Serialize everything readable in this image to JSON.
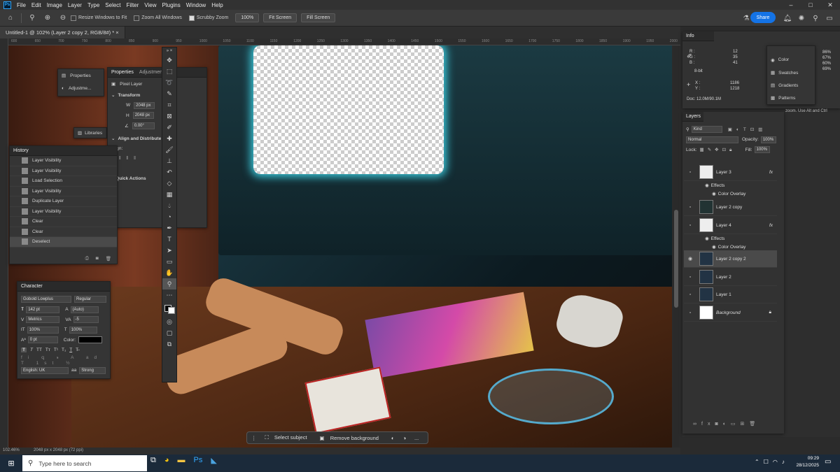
{
  "menubar": {
    "logo": "Ps",
    "items": [
      "File",
      "Edit",
      "Image",
      "Layer",
      "Type",
      "Select",
      "Filter",
      "View",
      "Plugins",
      "Window",
      "Help"
    ],
    "window_controls": [
      "–",
      "□",
      "✕"
    ]
  },
  "options": {
    "resize_windows": "Resize Windows to Fit",
    "zoom_all": "Zoom All Windows",
    "scrubby_zoom": "Scrubby Zoom",
    "zoom_btn": "100%",
    "fit_screen": "Fit Screen",
    "fill_screen": "Fill Screen",
    "share": "Share"
  },
  "document": {
    "tab_title": "Untitled-1 @ 102% (Layer 2 copy 2, RGB/8#) *",
    "zoom_status": "102.46%",
    "size_status": "2048 px x 2048 px (72 ppi)"
  },
  "ruler": {
    "marks": [
      "600",
      "650",
      "700",
      "750",
      "800",
      "850",
      "900",
      "950",
      "1000",
      "1050",
      "1100",
      "1150",
      "1200",
      "1250",
      "1300",
      "1350",
      "1400",
      "1450",
      "1500",
      "1550",
      "1600",
      "1650",
      "1700",
      "1750",
      "1800",
      "1850",
      "1900",
      "1950",
      "2000",
      "2050"
    ]
  },
  "properties": {
    "collapsed_labels": [
      "Properties",
      "Adjustme...",
      "Libraries"
    ],
    "tabs": [
      "Properties",
      "Adjustmen"
    ],
    "kind": "Pixel Layer",
    "transform_title": "Transform",
    "w_label": "W",
    "w_value": "2048 px",
    "h_label": "H",
    "h_value": "2048 px",
    "angle_value": "0.00°",
    "align_title": "Align and Distribute",
    "align_label": "Align:",
    "quick_actions": "Quick Actions"
  },
  "history": {
    "title": "History",
    "items": [
      "Layer Visibility",
      "Layer Visibility",
      "Load Selection",
      "Layer Visibility",
      "Duplicate Layer",
      "Layer Visibility",
      "Clear",
      "Clear",
      "Deselect"
    ]
  },
  "character": {
    "title": "Character",
    "font": "Gobold Lowplus",
    "style": "Regular",
    "size": "142 pt",
    "leading": "(Auto)",
    "kerning": "Metrics",
    "tracking": "-5",
    "vscale": "100%",
    "hscale": "100%",
    "baseline": "0 pt",
    "color_label": "Color:",
    "type_buttons": [
      "T",
      "T",
      "TT",
      "Tт",
      "T¹",
      "T₁",
      "T",
      "T̶"
    ],
    "language": "English: UK",
    "aa": "Strong",
    "aa_label": "aa"
  },
  "info": {
    "title": "Info",
    "r_label": "R :",
    "r": "12",
    "g_label": "G :",
    "g": "35",
    "b_label": "B :",
    "b": "41",
    "c": "86%",
    "m": "67%",
    "y": "60%",
    "k": "69%",
    "bit": "8-bit",
    "x_label": "X :",
    "x": "1186",
    "y_label": "Y :",
    "y_val": "1218",
    "doc": "Doc: 12.0M/90.1M",
    "hint": "zoom.  Use Alt and Ctrl"
  },
  "mini_panels": [
    "Color",
    "Swatches",
    "Gradients",
    "Patterns"
  ],
  "layers_panel": {
    "title": "Layers",
    "filter": "Kind",
    "blend": "Normal",
    "opacity_label": "Opacity:",
    "opacity": "100%",
    "lock_label": "Lock:",
    "fill_label": "Fill:",
    "fill": "100%",
    "effects_label": "Effects",
    "overlay_label": "Color Overlay",
    "fx": "fx",
    "layers": [
      "Layer 3",
      "Layer 2 copy",
      "Layer 4",
      "Layer 2 copy 2",
      "Layer 2",
      "Layer 1",
      "Background"
    ]
  },
  "ctx_bar": {
    "select_subject": "Select subject",
    "remove_bg": "Remove background",
    "more": "..."
  },
  "taskbar": {
    "search": "Type here to search",
    "time": "09:29",
    "date": "28/12/2025"
  },
  "colors": {
    "accent": "#1473e6",
    "ps_blue": "#31a8ff",
    "selected_layer": "#4a4a4a"
  }
}
